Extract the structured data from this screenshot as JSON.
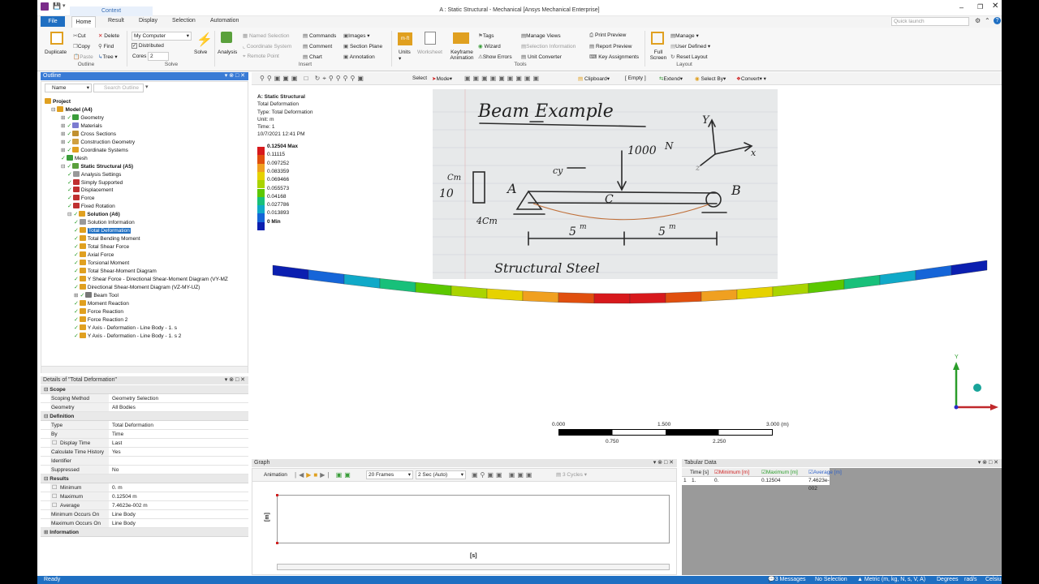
{
  "window": {
    "title": "A : Static Structural - Mechanical [Ansys Mechanical Enterprise]",
    "context_label": "Context",
    "quick_launch_placeholder": "Quick launch"
  },
  "tabs": [
    "File",
    "Home",
    "Result",
    "Display",
    "Selection",
    "Automation"
  ],
  "ribbon": {
    "outline": {
      "duplicate": "Duplicate",
      "cut": "Cut",
      "delete": "Delete",
      "copy": "Copy",
      "find": "Find",
      "paste": "Paste",
      "tree": "Tree",
      "group": "Outline"
    },
    "solve": {
      "computer": "My Computer",
      "distributed": "Distributed",
      "cores_label": "Cores",
      "cores_value": "2",
      "solve": "Solve",
      "group": "Solve"
    },
    "insert": {
      "analysis": "Analysis",
      "named_selection": "Named Selection",
      "coordinate_system": "Coordinate System",
      "remote_point": "Remote Point",
      "commands": "Commands",
      "comment": "Comment",
      "chart": "Chart",
      "images": "Images",
      "section_plane": "Section Plane",
      "annotation": "Annotation",
      "group": "Insert"
    },
    "tools": {
      "units": "Units",
      "worksheet": "Worksheet",
      "keyframe": "Keyframe Animation",
      "tags": "Tags",
      "wizard": "Wizard",
      "show_errors": "Show Errors",
      "manage_views": "Manage Views",
      "selection_information": "Selection Information",
      "unit_converter": "Unit Converter",
      "print_preview": "Print Preview",
      "report_preview": "Report Preview",
      "key_assignments": "Key Assignments",
      "group": "Tools"
    },
    "layout": {
      "full_screen": "Full Screen",
      "manage": "Manage",
      "user_defined": "User Defined",
      "reset_layout": "Reset Layout",
      "group": "Layout"
    }
  },
  "outline": {
    "title": "Outline",
    "name_filter": "Name",
    "search_placeholder": "Search Outline",
    "items": [
      "Project",
      "Model (A4)",
      "Geometry",
      "Materials",
      "Cross Sections",
      "Construction Geometry",
      "Coordinate Systems",
      "Mesh",
      "Static Structural (A5)",
      "Analysis Settings",
      "Simply Supported",
      "Displacement",
      "Force",
      "Fixed Rotation",
      "Solution (A6)",
      "Solution Information",
      "Total Deformation",
      "Total Bending Moment",
      "Total Shear Force",
      "Axial Force",
      "Torsional Moment",
      "Total Shear-Moment Diagram",
      "Y Shear Force - Directional Shear-Moment Diagram (VY-MZ",
      "Directional Shear-Moment Diagram (VZ-MY-UZ)",
      "Beam Tool",
      "Moment Reaction",
      "Force Reaction",
      "Force Reaction 2",
      "Y Axis - Deformation - Line Body - 1. s",
      "Y Axis - Deformation - Line Body - 1. s 2"
    ]
  },
  "details": {
    "title": "Details of \"Total Deformation\"",
    "sections": {
      "scope": "Scope",
      "definition": "Definition",
      "results": "Results",
      "information": "Information"
    },
    "scope": [
      [
        "Scoping Method",
        "Geometry Selection"
      ],
      [
        "Geometry",
        "All Bodies"
      ]
    ],
    "definition": [
      [
        "Type",
        "Total Deformation"
      ],
      [
        "By",
        "Time"
      ],
      [
        "Display Time",
        "Last"
      ],
      [
        "Calculate Time History",
        "Yes"
      ],
      [
        "Identifier",
        ""
      ],
      [
        "Suppressed",
        "No"
      ]
    ],
    "results": [
      [
        "Minimum",
        "0. m"
      ],
      [
        "Maximum",
        "0.12504 m"
      ],
      [
        "Average",
        "7.4623e-002 m"
      ],
      [
        "Minimum Occurs On",
        "Line Body"
      ],
      [
        "Maximum Occurs On",
        "Line Body"
      ]
    ]
  },
  "graphics_toolbar": {
    "select": "Select",
    "mode": "Mode",
    "clipboard": "Clipboard",
    "empty": "[ Empty ]",
    "extend": "Extend",
    "select_by": "Select By",
    "convert": "Convert"
  },
  "result_info": {
    "line1": "A: Static Structural",
    "line2": "Total Deformation",
    "line3": "Type: Total Deformation",
    "line4": "Unit: m",
    "line5": "Time: 1",
    "line6": "10/7/2021 12:41 PM"
  },
  "legend": {
    "labels": [
      "0.12504 Max",
      "0.11115",
      "0.097252",
      "0.083359",
      "0.069466",
      "0.055573",
      "0.04168",
      "0.027786",
      "0.013893",
      "0 Min"
    ],
    "colors": [
      "#d7191c",
      "#e04f0e",
      "#f0a020",
      "#e6d200",
      "#aad400",
      "#5cc800",
      "#18c07a",
      "#10a9c8",
      "#1565d8",
      "#0b1fb0"
    ]
  },
  "sketch": {
    "title": "Beam Example",
    "force": "1000",
    "force_unit": "N",
    "section_h": "10",
    "section_unit": "Cm",
    "section_w": "4Cm",
    "point_a": "A",
    "point_b": "B",
    "point_c": "C",
    "span1": "5",
    "span2": "5",
    "span_unit": "m",
    "material": "Structural Steel",
    "axis_y": "Y",
    "axis_x": "x",
    "axis_z": "z"
  },
  "beam_colors": [
    "#0b1fb0",
    "#1565d8",
    "#10a9c8",
    "#18c07a",
    "#5cc800",
    "#aad400",
    "#e6d200",
    "#f0a020",
    "#e04f0e",
    "#d7191c",
    "#d7191c",
    "#e04f0e",
    "#f0a020",
    "#e6d200",
    "#aad400",
    "#5cc800",
    "#18c07a",
    "#10a9c8",
    "#1565d8",
    "#0b1fb0"
  ],
  "scale": {
    "t0": "0.000",
    "t1": "1.500",
    "t2": "3.000 (m)",
    "b0": "0.750",
    "b1": "2.250"
  },
  "triad": {
    "y": "Y"
  },
  "graph": {
    "title": "Graph",
    "animation": "Animation",
    "frames": "20 Frames",
    "duration": "2 Sec (Auto)",
    "cycles": "3 Cycles",
    "y_unit": "[m]",
    "x_unit": "[s]"
  },
  "tabular": {
    "title": "Tabular Data",
    "headers": [
      "Time [s]",
      "Minimum [m]",
      "Maximum [m]",
      "Average [m]"
    ],
    "row": [
      "1",
      "1.",
      "0.",
      "0.12504",
      "7.4623e-002"
    ]
  },
  "status": {
    "ready": "Ready",
    "messages": "3 Messages",
    "selection": "No Selection",
    "units": "Metric (m, kg, N, s, V, A)",
    "angle": "Degrees",
    "rate": "rad/s",
    "temp": "Celsius"
  }
}
